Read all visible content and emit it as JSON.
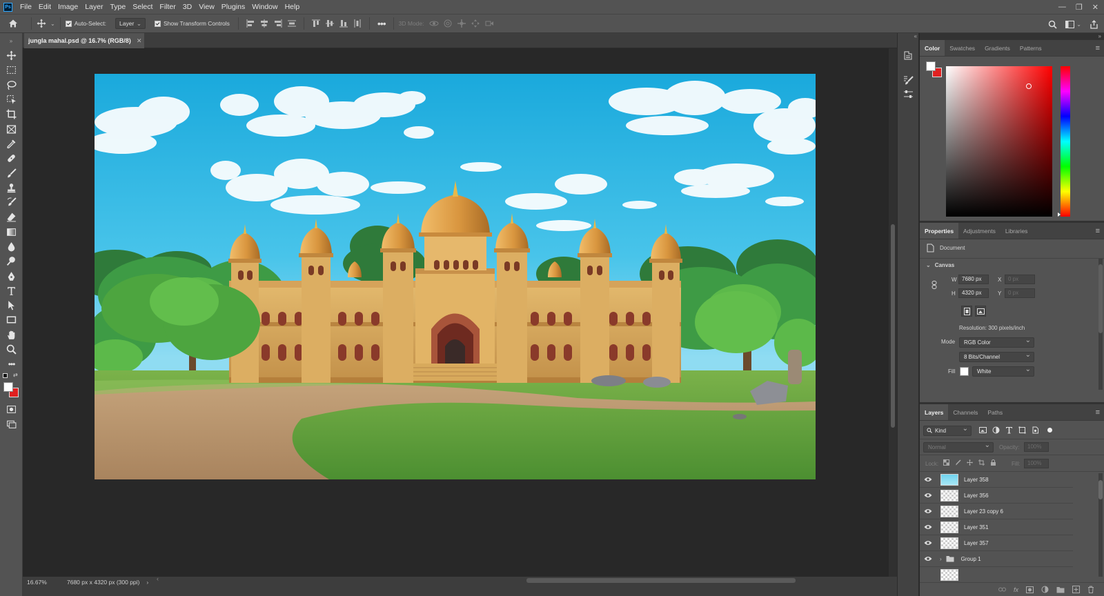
{
  "app": {
    "logo": "Ps"
  },
  "menu": [
    "File",
    "Edit",
    "Image",
    "Layer",
    "Type",
    "Select",
    "Filter",
    "3D",
    "View",
    "Plugins",
    "Window",
    "Help"
  ],
  "options_bar": {
    "auto_select_label": "Auto-Select:",
    "auto_select_checked": true,
    "target_value": "Layer",
    "show_transform_label": "Show Transform Controls",
    "show_transform_checked": true,
    "mode_3d_label": "3D Mode:"
  },
  "document": {
    "tab_title": "jungla mahal.psd @ 16.7% (RGB/8)",
    "zoom": "16.67%",
    "doc_info": "7680 px x 4320 px (300 ppi)"
  },
  "color_panel": {
    "tabs": [
      "Color",
      "Swatches",
      "Gradients",
      "Patterns"
    ],
    "active_tab": "Color",
    "foreground": "#ffffff",
    "background": "#e02020",
    "hue_base": "#ff0000"
  },
  "properties_panel": {
    "tabs": [
      "Properties",
      "Adjustments",
      "Libraries"
    ],
    "doc_label": "Document",
    "section": "Canvas",
    "w_label": "W",
    "w_value": "7680 px",
    "h_label": "H",
    "h_value": "4320 px",
    "x_label": "X",
    "x_value": "0 px",
    "y_label": "Y",
    "y_value": "0 px",
    "resolution": "Resolution: 300 pixels/inch",
    "mode_label": "Mode",
    "mode_value": "RGB Color",
    "depth_value": "8 Bits/Channel",
    "fill_label": "Fill",
    "fill_value": "White"
  },
  "layers_panel": {
    "tabs": [
      "Layers",
      "Channels",
      "Paths"
    ],
    "filter_kind": "Kind",
    "blend_mode": "Normal",
    "opacity_label": "Opacity:",
    "opacity_value": "100%",
    "lock_label": "Lock:",
    "fill_label": "Fill:",
    "fill_value": "100%",
    "layers": [
      {
        "name": "Layer 358",
        "thumb": "sky"
      },
      {
        "name": "Layer 356",
        "thumb": "transparent"
      },
      {
        "name": "Layer 23 copy 6",
        "thumb": "transparent"
      },
      {
        "name": "Layer 351",
        "thumb": "transparent"
      },
      {
        "name": "Layer 357",
        "thumb": "transparent"
      },
      {
        "name": "Group 1",
        "thumb": "folder"
      }
    ]
  }
}
